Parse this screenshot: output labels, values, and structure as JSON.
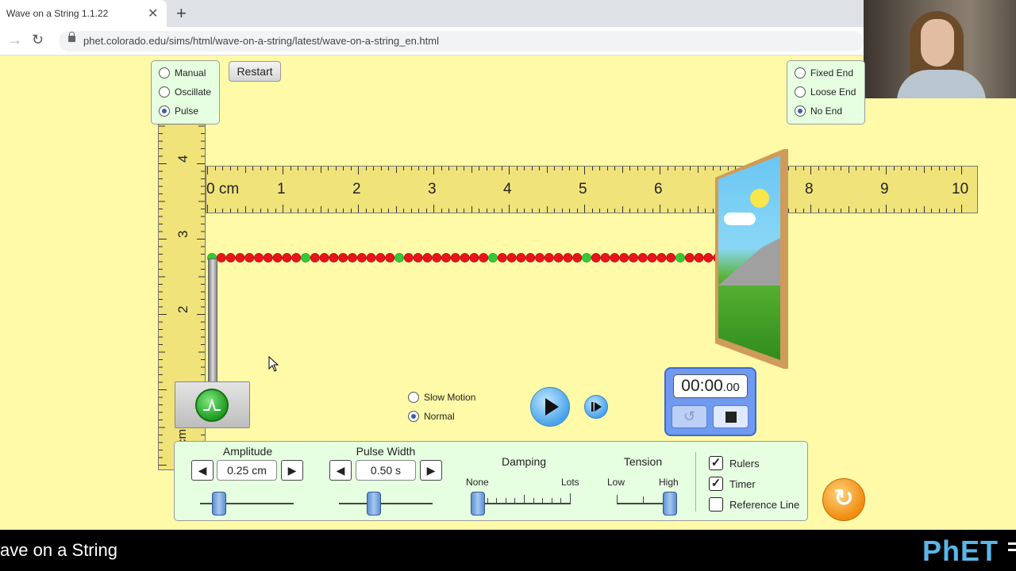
{
  "browser": {
    "tab_title": "Wave on a String 1.1.22",
    "url": "phet.colorado.edu/sims/html/wave-on-a-string/latest/wave-on-a-string_en.html"
  },
  "mode_panel": {
    "options": [
      {
        "label": "Manual",
        "selected": false
      },
      {
        "label": "Oscillate",
        "selected": false
      },
      {
        "label": "Pulse",
        "selected": true
      }
    ]
  },
  "restart_label": "Restart",
  "end_panel": {
    "options": [
      {
        "label": "Fixed End",
        "selected": false
      },
      {
        "label": "Loose End",
        "selected": false
      },
      {
        "label": "No End",
        "selected": true
      }
    ]
  },
  "vertical_ruler": {
    "labels": [
      "4",
      "3",
      "2",
      "1",
      "cm"
    ]
  },
  "horizontal_ruler": {
    "labels": [
      "0 cm",
      "1",
      "2",
      "3",
      "4",
      "5",
      "6",
      "7",
      "8",
      "9",
      "10"
    ]
  },
  "speed": {
    "options": [
      {
        "label": "Slow Motion",
        "selected": false
      },
      {
        "label": "Normal",
        "selected": true
      }
    ]
  },
  "timer": {
    "main": "00:00",
    "fraction": ".00"
  },
  "controls": {
    "amplitude": {
      "label": "Amplitude",
      "value": "0.25 cm",
      "fraction": 0.2
    },
    "pulse_width": {
      "label": "Pulse Width",
      "value": "0.50 s",
      "fraction": 0.37
    },
    "damping": {
      "label": "Damping",
      "min_label": "None",
      "max_label": "Lots",
      "fraction": 0.0
    },
    "tension": {
      "label": "Tension",
      "min_label": "Low",
      "max_label": "High",
      "fraction": 1.0
    }
  },
  "checkboxes": [
    {
      "label": "Rulers",
      "checked": true
    },
    {
      "label": "Timer",
      "checked": true
    },
    {
      "label": "Reference Line",
      "checked": false
    }
  ],
  "bottom_bar": {
    "title": "ave on a String",
    "logo": "PhET"
  },
  "colors": {
    "background": "#fffaa8",
    "panel": "#e6ffe1",
    "bead_red": "#e8141a",
    "bead_green": "#36c936",
    "play_blue": "#4aa3ea",
    "reset_orange": "#f08c10"
  }
}
